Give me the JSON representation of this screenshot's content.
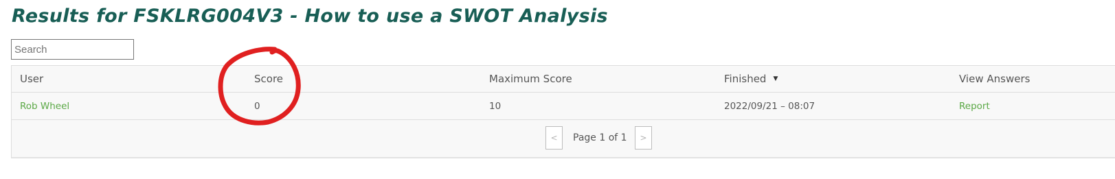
{
  "page": {
    "title": "Results for FSKLRG004V3 - How to use a SWOT Analysis"
  },
  "search": {
    "placeholder": "Search"
  },
  "table": {
    "columns": [
      "User",
      "Score",
      "Maximum Score",
      "Finished",
      "View Answers"
    ],
    "sort_indicator": "▼",
    "rows": [
      {
        "user": "Rob Wheel",
        "score": "0",
        "max_score": "10",
        "finished": "2022/09/21 – 08:07",
        "view": "Report"
      }
    ]
  },
  "pagination": {
    "prev": "<",
    "label": "Page 1 of 1",
    "next": ">"
  },
  "colors": {
    "title": "#185e55",
    "link": "#5aa845",
    "annotation": "#e02020"
  },
  "annotation": {
    "shape": "hand-drawn red circle",
    "target": "Score column"
  }
}
